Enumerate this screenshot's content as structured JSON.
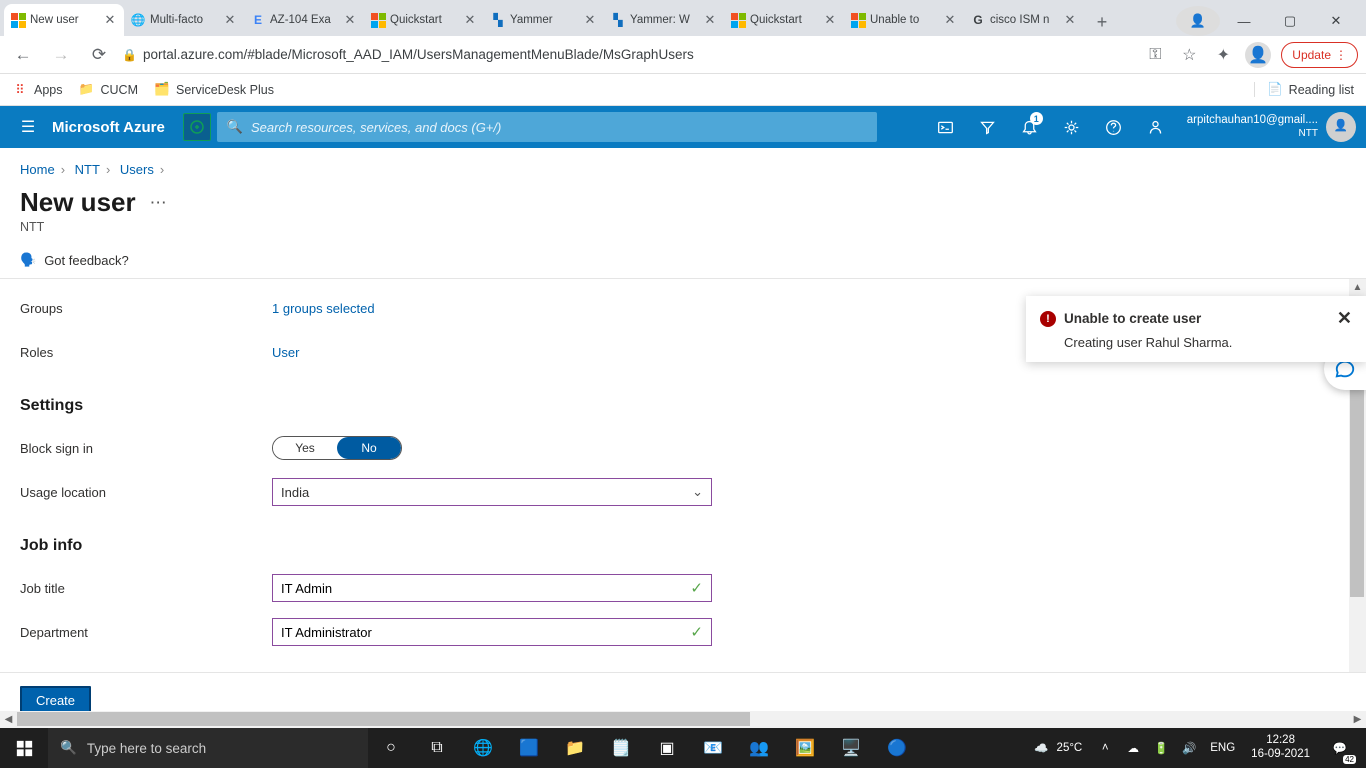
{
  "browser": {
    "tabs": [
      {
        "title": "New user"
      },
      {
        "title": "Multi-facto"
      },
      {
        "title": "AZ-104 Exa"
      },
      {
        "title": "Quickstart"
      },
      {
        "title": "Yammer"
      },
      {
        "title": "Yammer: W"
      },
      {
        "title": "Quickstart"
      },
      {
        "title": "Unable to"
      },
      {
        "title": "cisco ISM n"
      }
    ],
    "url": "portal.azure.com/#blade/Microsoft_AAD_IAM/UsersManagementMenuBlade/MsGraphUsers",
    "update_label": "Update",
    "bookmarks": {
      "apps": "Apps",
      "cucm": "CUCM",
      "sdp": "ServiceDesk Plus",
      "reading": "Reading list"
    }
  },
  "azure": {
    "brand": "Microsoft Azure",
    "search_placeholder": "Search resources, services, and docs (G+/)",
    "notif_badge": "1",
    "account_email": "arpitchauhan10@gmail....",
    "account_tenant": "NTT"
  },
  "breadcrumb": {
    "a": "Home",
    "b": "NTT",
    "c": "Users"
  },
  "page": {
    "title": "New user",
    "subtitle": "NTT",
    "feedback": "Got feedback?"
  },
  "form": {
    "groups_label": "Groups",
    "groups_value": "1 groups selected",
    "roles_label": "Roles",
    "roles_value": "User",
    "settings_header": "Settings",
    "block_label": "Block sign in",
    "block_yes": "Yes",
    "block_no": "No",
    "usage_label": "Usage location",
    "usage_value": "India",
    "job_header": "Job info",
    "jobtitle_label": "Job title",
    "jobtitle_value": "IT Admin",
    "dept_label": "Department",
    "dept_value": "IT Administrator"
  },
  "footer": {
    "create": "Create"
  },
  "toast": {
    "title": "Unable to create user",
    "body": "Creating user Rahul Sharma."
  },
  "taskbar": {
    "search_placeholder": "Type here to search",
    "weather": "25°C",
    "lang": "ENG",
    "time": "12:28",
    "date": "16-09-2021",
    "notif_count": "42"
  }
}
